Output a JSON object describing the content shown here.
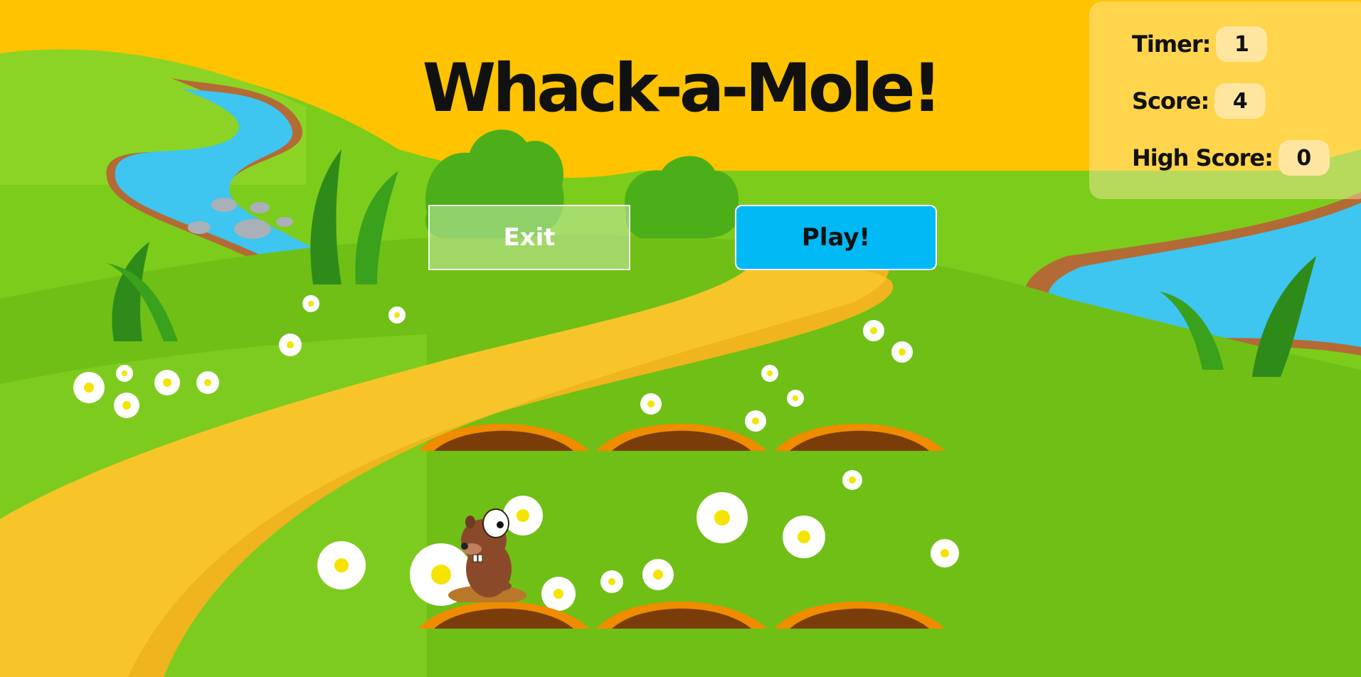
{
  "game": {
    "title": "Whack-a-Mole!",
    "buttons": {
      "exit": "Exit",
      "play": "Play!"
    },
    "stats": {
      "timer_label": "Timer:",
      "timer_value": "1",
      "score_label": "Score:",
      "score_value": "4",
      "high_score_label": "High Score:",
      "high_score_value": "0"
    },
    "holes": [
      {
        "row": 1,
        "col": 1,
        "mole_visible": false
      },
      {
        "row": 1,
        "col": 2,
        "mole_visible": false
      },
      {
        "row": 1,
        "col": 3,
        "mole_visible": false
      },
      {
        "row": 2,
        "col": 1,
        "mole_visible": true
      },
      {
        "row": 2,
        "col": 2,
        "mole_visible": false
      },
      {
        "row": 2,
        "col": 3,
        "mole_visible": false
      }
    ]
  },
  "colors": {
    "sky": "#ffc300",
    "grass": "#6fbf16",
    "path": "#f7c52a",
    "river": "#3ec5f0",
    "play_button": "#00b9f5"
  }
}
